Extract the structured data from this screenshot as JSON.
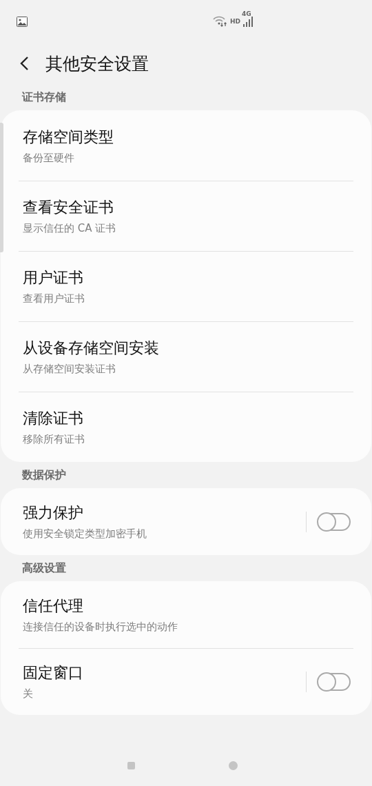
{
  "status_bar": {
    "hd": "HD",
    "network": "4G"
  },
  "header": {
    "title": "其他安全设置"
  },
  "sections": [
    {
      "title": "证书存储",
      "items": [
        {
          "kind": "link",
          "title": "存储空间类型",
          "subtitle": "备份至硬件"
        },
        {
          "kind": "link",
          "title": "查看安全证书",
          "subtitle": "显示信任的 CA 证书"
        },
        {
          "kind": "link",
          "title": "用户证书",
          "subtitle": "查看用户证书"
        },
        {
          "kind": "link",
          "title": "从设备存储空间安装",
          "subtitle": "从存储空间安装证书"
        },
        {
          "kind": "link",
          "title": "清除证书",
          "subtitle": "移除所有证书"
        }
      ]
    },
    {
      "title": "数据保护",
      "items": [
        {
          "kind": "toggle",
          "title": "强力保护",
          "subtitle": "使用安全锁定类型加密手机",
          "on": false
        }
      ]
    },
    {
      "title": "高级设置",
      "items": [
        {
          "kind": "link",
          "title": "信任代理",
          "subtitle": "连接信任的设备时执行选中的动作"
        },
        {
          "kind": "toggle",
          "title": "固定窗口",
          "subtitle": "关",
          "on": false
        }
      ]
    }
  ]
}
